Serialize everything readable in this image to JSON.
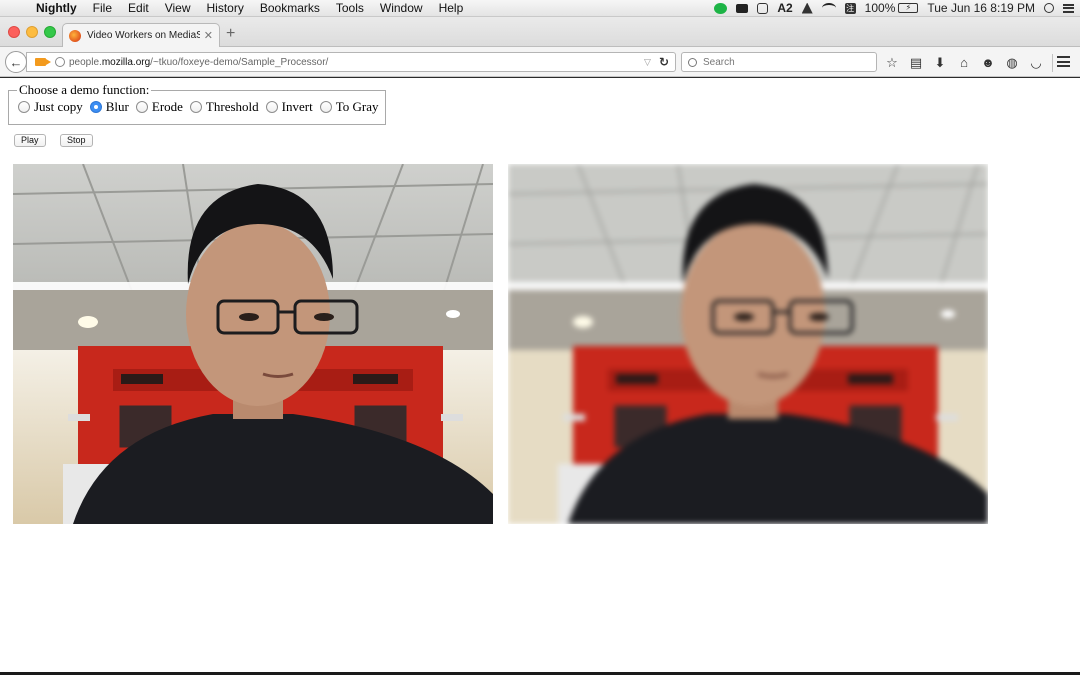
{
  "menubar": {
    "app_name": "Nightly",
    "items": [
      "File",
      "Edit",
      "View",
      "History",
      "Bookmarks",
      "Tools",
      "Window",
      "Help"
    ],
    "tray": {
      "notification_count": "2",
      "battery_percent": "100%",
      "battery_label": "⚡",
      "datetime": "Tue Jun 16  8:19 PM"
    }
  },
  "browser": {
    "tab": {
      "title": "Video Workers on MediaStr..."
    },
    "address": {
      "url_prefix": "people.",
      "url_domain": "mozilla.org",
      "url_path": "/~tkuo/foxeye-demo/Sample_Processor/"
    },
    "search": {
      "placeholder": "Search"
    }
  },
  "page": {
    "fieldset_legend": "Choose a demo function:",
    "options": [
      {
        "label": "Just copy",
        "checked": false
      },
      {
        "label": "Blur",
        "checked": true
      },
      {
        "label": "Erode",
        "checked": false
      },
      {
        "label": "Threshold",
        "checked": false
      },
      {
        "label": "Invert",
        "checked": false
      },
      {
        "label": "To Gray",
        "checked": false
      }
    ],
    "play_label": "Play",
    "stop_label": "Stop"
  },
  "colors": {
    "radio_selected": "#3c8ef3",
    "firefox_orange": "#f39a1d"
  }
}
